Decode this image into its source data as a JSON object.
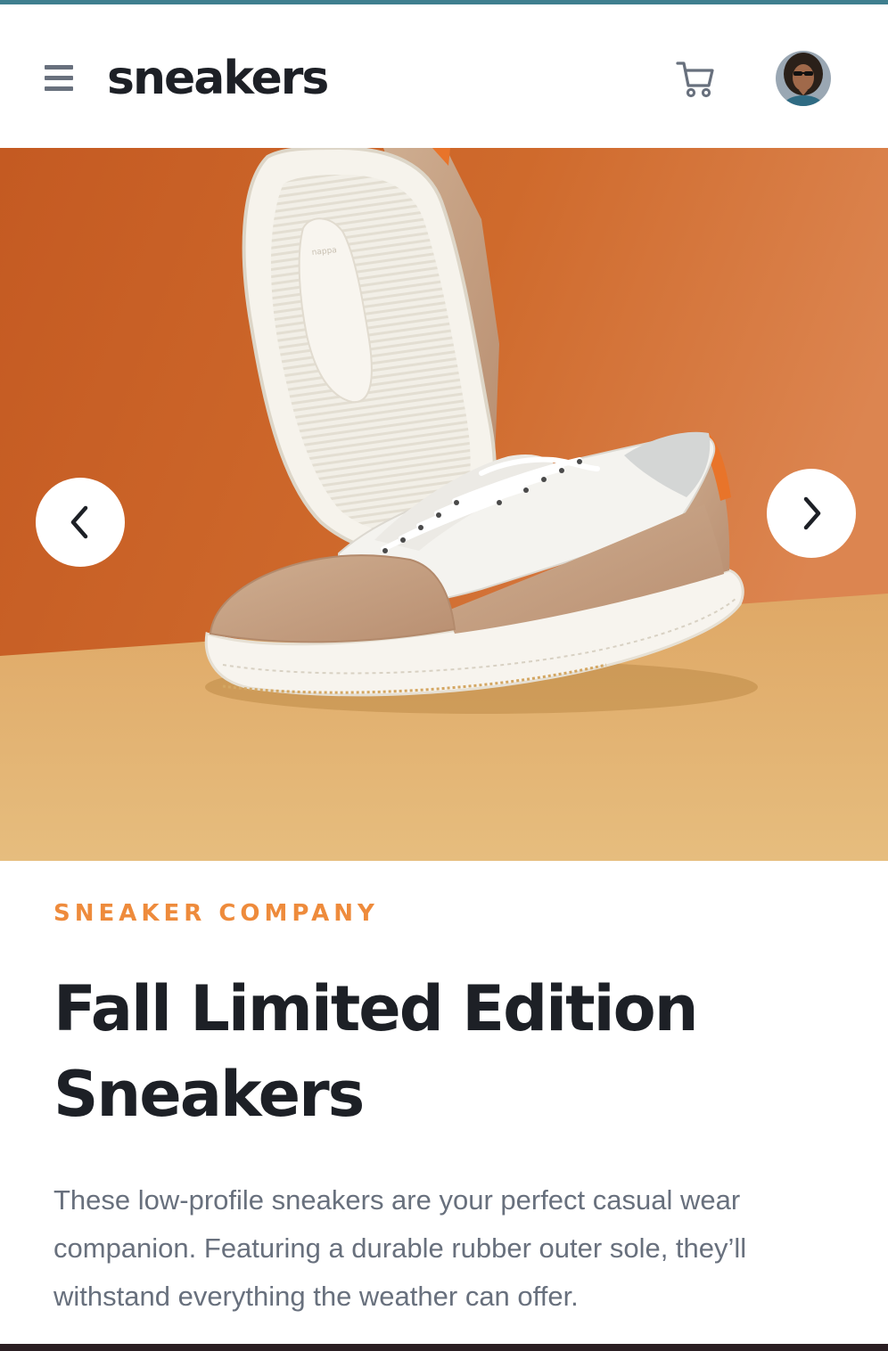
{
  "header": {
    "logo": "sneakers",
    "menu_icon": "hamburger-menu-icon",
    "cart_icon": "cart-icon",
    "avatar_icon": "user-avatar"
  },
  "gallery": {
    "image_alt": "Beige and white low-profile sneakers on an orange and tan background",
    "prev_icon": "chevron-left-icon",
    "next_icon": "chevron-right-icon"
  },
  "product": {
    "company": "SNEAKER COMPANY",
    "title": "Fall Limited Edition Sneakers",
    "description": "These low-profile sneakers are your perfect casual wear companion. Featuring a durable rubber outer sole, they’ll withstand everything the weather can offer."
  },
  "colors": {
    "accent": "#ee8b3c",
    "title": "#1d2026",
    "text": "#68707d",
    "hero_background": "#c9622a",
    "hero_floor": "#e2b06d"
  }
}
